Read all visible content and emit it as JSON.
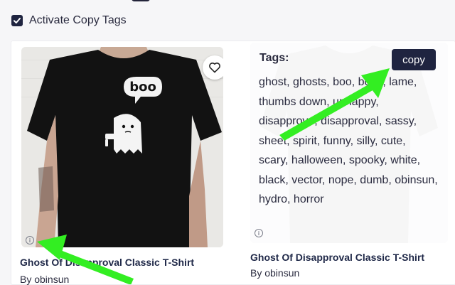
{
  "settings": {
    "activate_label": "Activate Copy Tags",
    "activate_checked": true
  },
  "products": [
    {
      "title": "Ghost Of Disapproval Classic T-Shirt",
      "author": "By obinsun",
      "shirt_text": "boo",
      "icons": [
        "heart-icon",
        "info-icon"
      ]
    },
    {
      "title": "Ghost Of Disapproval Classic T-Shirt",
      "author": "By obinsun",
      "tags_heading": "Tags:",
      "copy_label": "copy",
      "tags_text": "ghost, ghosts, boo, boos, lame, thumbs down, unhappy, disapprove, disapproval, sassy, sheet, spirit, funny, silly, cute, scary, halloween, spooky, white, black, vector, nope, dumb, obinsun, hydro, horror",
      "icons": [
        "info-icon"
      ]
    }
  ],
  "colors": {
    "accent": "#1f2440",
    "annotation_arrow": "#33ee22",
    "shirt": "#111111",
    "background": "#f6f6f8"
  }
}
